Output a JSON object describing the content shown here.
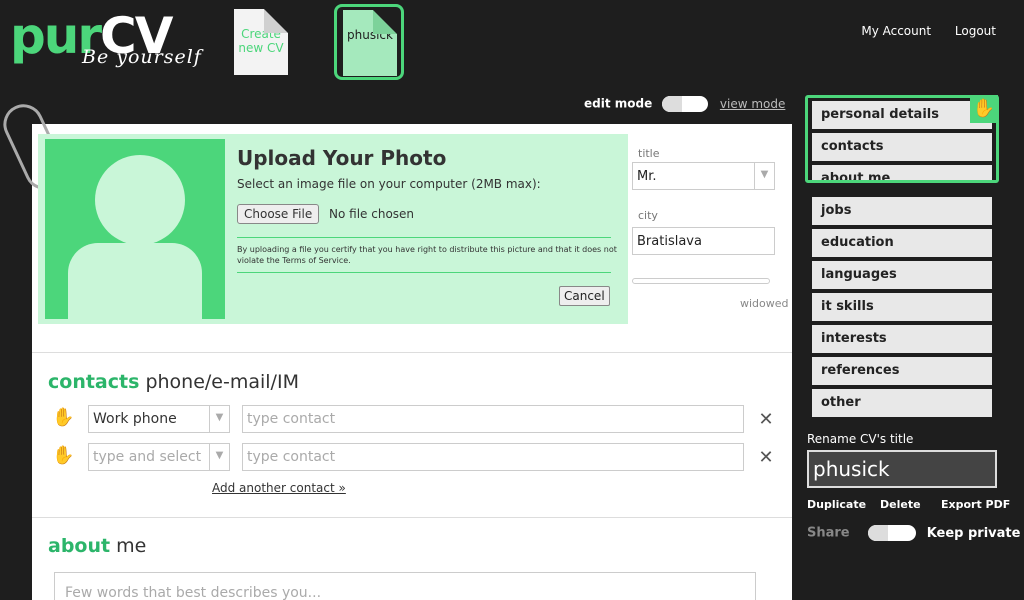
{
  "header": {
    "logo_pur": "pur",
    "logo_cv": "CV",
    "logo_tagline": "Be yourself",
    "create_cv_line1": "Create",
    "create_cv_line2": "new CV",
    "active_cv": "phusick",
    "my_account": "My Account",
    "logout": "Logout"
  },
  "mode": {
    "edit_label": "edit mode",
    "view_label": "view mode"
  },
  "upload": {
    "title": "Upload Your Photo",
    "hint": "Select an image file on your computer (2MB max):",
    "choose_file": "Choose File",
    "no_file": "No file chosen",
    "terms": "By uploading a file you certify that you have right to distribute this picture and that it does not violate the Terms of Service.",
    "cancel": "Cancel"
  },
  "personal": {
    "title_label": "title",
    "title_value": "Mr.",
    "city_label": "city",
    "city_value": "Bratislava",
    "marital_value": "widowed"
  },
  "contacts": {
    "title_strong": "contacts",
    "title_rest": " phone/e-mail/IM",
    "rows": [
      {
        "type": "Work phone",
        "value_placeholder": "type contact"
      },
      {
        "type_placeholder": "type and select",
        "value_placeholder": "type contact"
      }
    ],
    "add_link": "Add another contact »"
  },
  "about": {
    "title_strong": "about",
    "title_rest": " me",
    "placeholder": "Few words that best describes you..."
  },
  "sidebar": {
    "items": [
      {
        "label": "personal details"
      },
      {
        "label": "contacts"
      },
      {
        "label": "about me"
      },
      {
        "label": "jobs"
      },
      {
        "label": "education"
      },
      {
        "label": "languages"
      },
      {
        "label": "it skills"
      },
      {
        "label": "interests"
      },
      {
        "label": "references"
      },
      {
        "label": "other"
      }
    ],
    "rename_label": "Rename CV's title",
    "rename_value": "phusick",
    "duplicate": "Duplicate",
    "delete": "Delete",
    "export_pdf": "Export PDF",
    "share": "Share",
    "keep_private": "Keep private"
  },
  "colors": {
    "accent": "#4cd67b",
    "dark_bg": "#1e1e1e",
    "upload_bg": "#c9f6d8"
  }
}
